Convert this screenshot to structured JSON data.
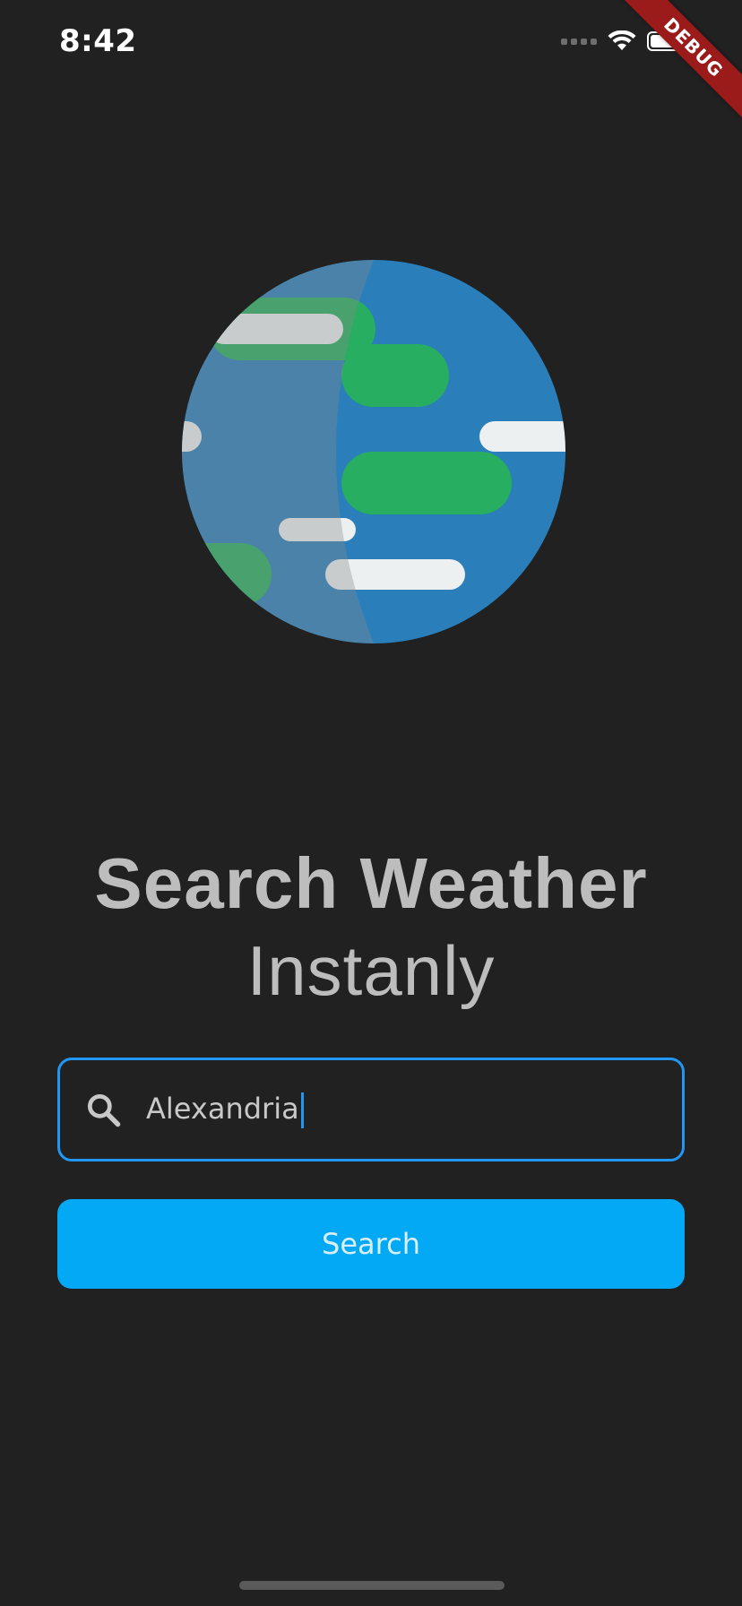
{
  "status_bar": {
    "time": "8:42",
    "icons": [
      "signal-icon",
      "wifi-icon",
      "battery-icon"
    ]
  },
  "debug_banner": {
    "label": "DEBUG",
    "color": "#9b1a1a"
  },
  "hero": {
    "illustration": "globe-illustration",
    "colors": {
      "ocean": "#2a7fba",
      "land": "#27ae60",
      "cloud": "#ecf0f1"
    }
  },
  "title": {
    "main": "Search Weather",
    "sub": "Instanly"
  },
  "search": {
    "value": "Alexandria",
    "icon": "search-icon",
    "border_color": "#2196f3"
  },
  "search_button": {
    "label": "Search",
    "color": "#03a9f4"
  },
  "theme": {
    "background": "#212121",
    "text": "#bdbdbd"
  }
}
